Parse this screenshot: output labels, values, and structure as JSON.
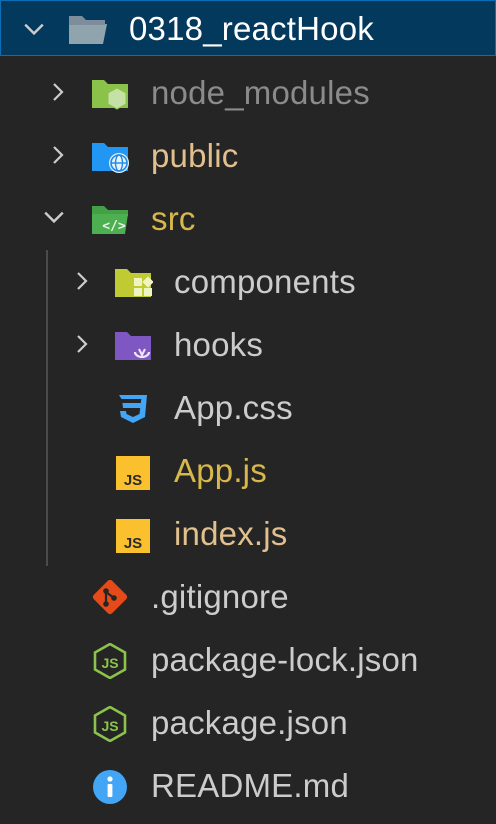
{
  "colors": {
    "background": "#252526",
    "selected_row": "#04395e",
    "text_default": "#cccccc",
    "text_ignored": "#8b8b8b",
    "text_modified": "#e2c08d",
    "text_untracked": "#d8b84a"
  },
  "explorer": {
    "root": {
      "label": "0318_reactHook",
      "icon": "folder-open-icon",
      "expanded": true
    },
    "items": [
      {
        "label": "node_modules",
        "icon": "node-folder-icon",
        "type": "folder",
        "expanded": false
      },
      {
        "label": "public",
        "icon": "public-folder-icon",
        "type": "folder",
        "expanded": false
      },
      {
        "label": "src",
        "icon": "src-folder-icon",
        "type": "folder",
        "expanded": true
      },
      {
        "label": "components",
        "icon": "components-folder-icon",
        "type": "folder",
        "expanded": false
      },
      {
        "label": "hooks",
        "icon": "hooks-folder-icon",
        "type": "folder",
        "expanded": false
      },
      {
        "label": "App.css",
        "icon": "css-icon",
        "type": "file"
      },
      {
        "label": "App.js",
        "icon": "js-icon",
        "type": "file"
      },
      {
        "label": "index.js",
        "icon": "js-icon",
        "type": "file"
      },
      {
        "label": ".gitignore",
        "icon": "git-icon",
        "type": "file"
      },
      {
        "label": "package-lock.json",
        "icon": "nodejs-icon",
        "type": "file"
      },
      {
        "label": "package.json",
        "icon": "nodejs-icon",
        "type": "file"
      },
      {
        "label": "README.md",
        "icon": "info-icon",
        "type": "file"
      }
    ]
  }
}
